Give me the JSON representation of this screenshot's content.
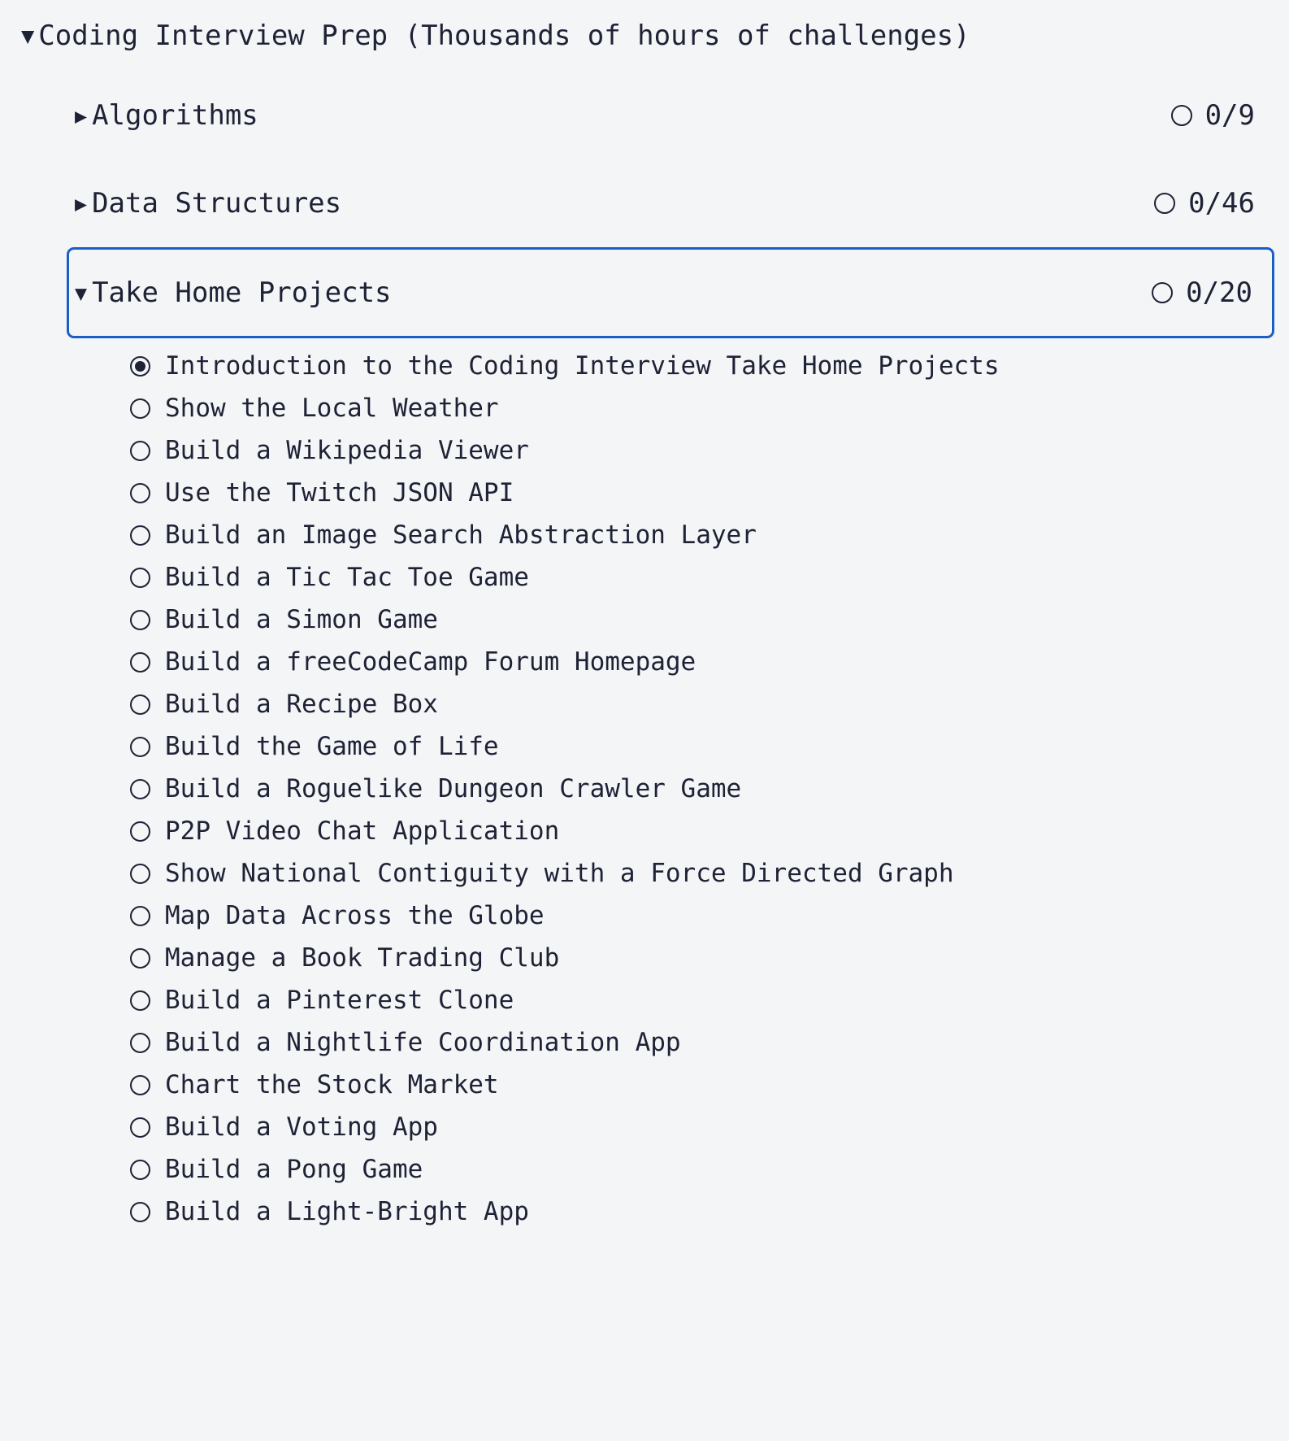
{
  "theme": {
    "background": "#f4f5f7",
    "text_color": "#1e2235",
    "focus_border_color": "#1a5fc4"
  },
  "root": {
    "caret_icon": "caret-down-icon",
    "caret_glyph": "▼",
    "title": "Coding Interview Prep (Thousands of hours of challenges)"
  },
  "sections": [
    {
      "label": "Algorithms",
      "caret_icon": "caret-right-icon",
      "caret_glyph": "▶",
      "expanded": false,
      "focused": false,
      "status_icon": "circle-empty-icon",
      "count": "0/9"
    },
    {
      "label": "Data Structures",
      "caret_icon": "caret-right-icon",
      "caret_glyph": "▶",
      "expanded": false,
      "focused": false,
      "status_icon": "circle-empty-icon",
      "count": "0/46"
    },
    {
      "label": "Take Home Projects",
      "caret_icon": "caret-down-icon",
      "caret_glyph": "▼",
      "expanded": true,
      "focused": true,
      "status_icon": "circle-empty-icon",
      "count": "0/20"
    }
  ],
  "challenges": [
    {
      "label": "Introduction to the Coding Interview Take Home Projects",
      "selected": true
    },
    {
      "label": "Show the Local Weather",
      "selected": false
    },
    {
      "label": "Build a Wikipedia Viewer",
      "selected": false
    },
    {
      "label": "Use the Twitch JSON API",
      "selected": false
    },
    {
      "label": "Build an Image Search Abstraction Layer",
      "selected": false
    },
    {
      "label": "Build a Tic Tac Toe Game",
      "selected": false
    },
    {
      "label": "Build a Simon Game",
      "selected": false
    },
    {
      "label": "Build a freeCodeCamp Forum Homepage",
      "selected": false
    },
    {
      "label": "Build a Recipe Box",
      "selected": false
    },
    {
      "label": "Build the Game of Life",
      "selected": false
    },
    {
      "label": "Build a Roguelike Dungeon Crawler Game",
      "selected": false
    },
    {
      "label": "P2P Video Chat Application",
      "selected": false
    },
    {
      "label": "Show National Contiguity with a Force Directed Graph",
      "selected": false
    },
    {
      "label": "Map Data Across the Globe",
      "selected": false
    },
    {
      "label": "Manage a Book Trading Club",
      "selected": false
    },
    {
      "label": "Build a Pinterest Clone",
      "selected": false
    },
    {
      "label": "Build a Nightlife Coordination App",
      "selected": false
    },
    {
      "label": "Chart the Stock Market",
      "selected": false
    },
    {
      "label": "Build a Voting App",
      "selected": false
    },
    {
      "label": "Build a Pong Game",
      "selected": false
    },
    {
      "label": "Build a Light-Bright App",
      "selected": false
    }
  ]
}
